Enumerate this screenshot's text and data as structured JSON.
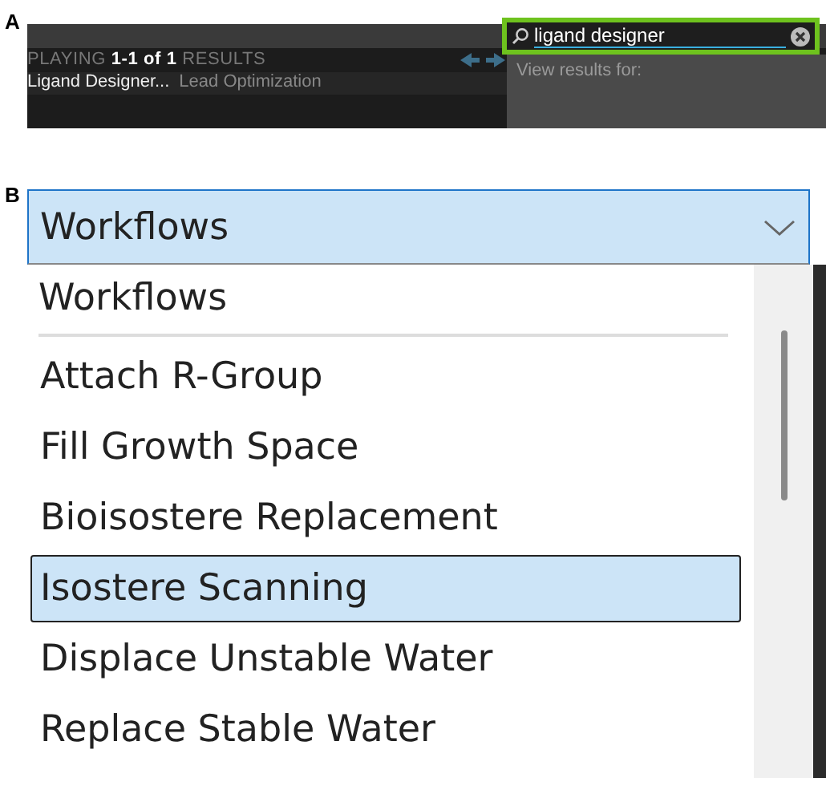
{
  "panel_a": {
    "label": "A",
    "results_header": "PLAYING **1-1 of 1** RESULTS",
    "result": {
      "title": "Ligand Designer...",
      "category": "Lead Optimization"
    },
    "search": {
      "value": "ligand designer"
    },
    "suggestions": {
      "heading": "View results for:"
    }
  },
  "panel_b": {
    "label": "B",
    "combo": {
      "value": "Workflows",
      "expanded": true
    },
    "list": {
      "header": "Workflows",
      "items": [
        {
          "label": "Attach R-Group",
          "selected": false
        },
        {
          "label": "Fill Growth Space",
          "selected": false
        },
        {
          "label": "Bioisostere Replacement",
          "selected": false
        },
        {
          "label": "Isostere Scanning",
          "selected": true
        },
        {
          "label": "Displace Unstable Water",
          "selected": false
        },
        {
          "label": "Replace Stable Water",
          "selected": false
        }
      ]
    }
  }
}
